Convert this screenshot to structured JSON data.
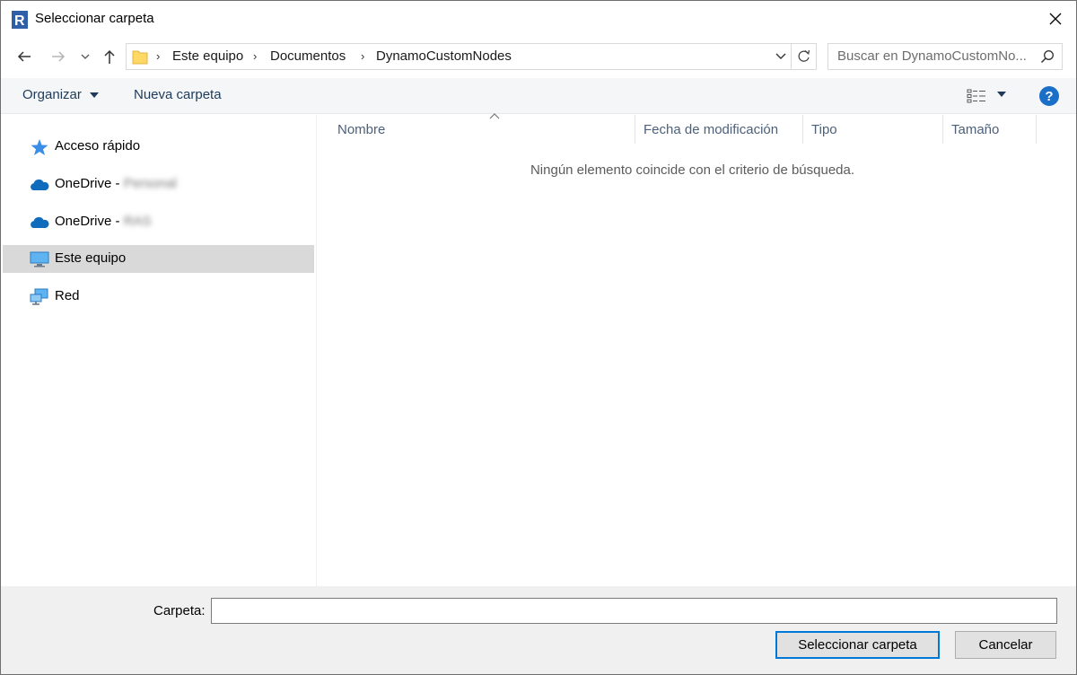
{
  "window": {
    "title": "Seleccionar carpeta"
  },
  "address": {
    "breadcrumbs": [
      "Este equipo",
      "Documentos",
      "DynamoCustomNodes"
    ]
  },
  "search": {
    "placeholder": "Buscar en DynamoCustomNo..."
  },
  "toolbar": {
    "organize_label": "Organizar",
    "new_folder_label": "Nueva carpeta"
  },
  "navpane": {
    "items": [
      {
        "label": "Acceso rápido",
        "icon": "star-icon"
      },
      {
        "label": "OneDrive - ",
        "suffix": "Personal",
        "icon": "cloud-icon"
      },
      {
        "label": "OneDrive - ",
        "suffix": "RAS",
        "icon": "cloud-icon"
      },
      {
        "label": "Este equipo",
        "icon": "computer-icon",
        "selected": true
      },
      {
        "label": "Red",
        "icon": "network-icon"
      }
    ]
  },
  "content": {
    "columns": [
      "Nombre",
      "Fecha de modificación",
      "Tipo",
      "Tamaño"
    ],
    "empty_message": "Ningún elemento coincide con el criterio de búsqueda."
  },
  "footer": {
    "folder_label": "Carpeta:",
    "folder_value": "",
    "select_button": "Seleccionar carpeta",
    "cancel_button": "Cancelar"
  },
  "colors": {
    "accent": "#0078d7",
    "selected_bg": "#d9d9d9",
    "help_blue": "#1a6fc9",
    "folder_yellow": "#ffd866"
  }
}
